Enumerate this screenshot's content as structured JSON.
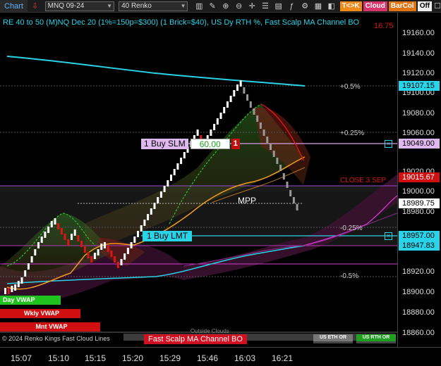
{
  "toolbar": {
    "chart_label": "Chart",
    "instrument": "MNQ 09-24",
    "bar_type": "40 Renko",
    "tk": "T<>K",
    "cloud": "Cloud",
    "barcol": "BarCol",
    "off": "Off"
  },
  "chart": {
    "title": "RE 40 to 50 (M)NQ Dec 20 (1%=150p=$300) (1 Brick=$40), US Dy RTH %, Fast Scalp MA Channel BO",
    "overlay_value": "16.75",
    "copyright": "© 2024 Renko Kings Fast Cloud Lines",
    "fast_scalp_label": "Fast Scalp MA Channel BO",
    "outside_clouds": "Outside Clouds",
    "us_eth_or": "US ETH OR",
    "us_rth_or": "US RTH OR"
  },
  "levels": {
    "pct_plus_05": "+0.5%",
    "pct_plus_025": "+0.25%",
    "close": "CLOSE 3 SEP",
    "mpp": "MPP",
    "pct_minus_025": "-0.25%",
    "pct_minus_05": "-0.5%"
  },
  "orders": {
    "buy_slm": "1 Buy SLM",
    "slm_price": "60.00",
    "slm_qty": "1",
    "buy_lmt": "1 Buy LMT"
  },
  "vwap": {
    "day": "Day VWAP",
    "wkly": "Wkly VWAP",
    "mnt": "Mnt VWAP"
  },
  "yaxis": {
    "ticks": [
      "19160.00",
      "19140.00",
      "19120.00",
      "19100.00",
      "19080.00",
      "19060.00",
      "19040.00",
      "19020.00",
      "19000.00",
      "18980.00",
      "18960.00",
      "18940.00",
      "18920.00",
      "18900.00",
      "18880.00",
      "18860.00"
    ],
    "tag_107": "19107.15",
    "tag_049": "19049.00",
    "tag_015": "19015.67",
    "tag_989": "18989.75",
    "tag_957": "18957.00",
    "tag_947": "18947.83"
  },
  "xaxis": {
    "ticks": [
      "15:07",
      "15:10",
      "15:15",
      "15:20",
      "15:29",
      "15:46",
      "16:03",
      "16:21"
    ]
  },
  "colors": {
    "cyan": "#29d3e8",
    "magenta": "#d93ad9",
    "red": "#e01414",
    "green": "#1fc21f",
    "orange": "#f09a1e"
  }
}
